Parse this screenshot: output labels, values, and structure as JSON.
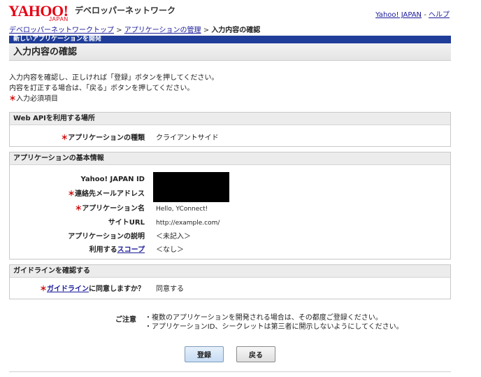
{
  "header": {
    "logo_text": "YAHOO!",
    "logo_sub": "JAPAN",
    "site_title": "デベロッパーネットワーク",
    "link_yahoo": "Yahoo! JAPAN",
    "separator": " - ",
    "link_help": "ヘルプ"
  },
  "breadcrumb": {
    "item1": "デベロッパーネットワークトップ",
    "item2": "アプリケーションの管理",
    "sep": " > ",
    "current": "入力内容の確認"
  },
  "section_label": "新しいアプリケーションを開発",
  "page_title": "入力内容の確認",
  "intro": {
    "line1": "入力内容を確認し、正しければ「登録」ボタンを押してください。",
    "line2": "内容を訂正する場合は、「戻る」ボタンを押してください。",
    "required_mark": "＊",
    "required_text": "入力必須項目"
  },
  "panel_api": {
    "title": "Web APIを利用する場所",
    "type_label": "アプリケーションの種類",
    "type_value": "クライアントサイド"
  },
  "panel_basic": {
    "title": "アプリケーションの基本情報",
    "id_label": "Yahoo! JAPAN ID",
    "email_label": "連絡先メールアドレス",
    "name_label": "アプリケーション名",
    "name_value": "Hello, YConnect!",
    "url_label": "サイトURL",
    "url_value": "http://example.com/",
    "desc_label": "アプリケーションの説明",
    "desc_value": "＜未記入＞",
    "scope_label_prefix": "利用する",
    "scope_link": "スコープ",
    "scope_value": "＜なし＞"
  },
  "panel_guideline": {
    "title": "ガイドラインを確認する",
    "link": "ガイドライン",
    "label_suffix": "に同意しますか？",
    "value": "同意する"
  },
  "notes": {
    "label": "ご注意",
    "line1": "・複数のアプリケーションを開発される場合は、その都度ご登録ください。",
    "line2": "・アプリケーションID、シークレットは第三者に開示しないようにしてください。"
  },
  "buttons": {
    "submit": "登録",
    "back": "戻る"
  },
  "colors": {
    "brand_red": "#e60012",
    "section_blue": "#1f3d99",
    "required_red": "#cc0000"
  }
}
